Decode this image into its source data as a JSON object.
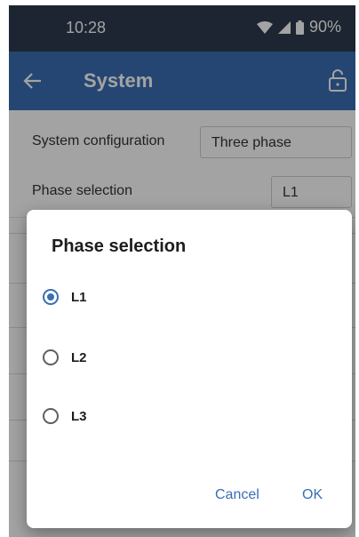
{
  "status_bar": {
    "time": "10:28",
    "battery": "90%"
  },
  "app_bar": {
    "title": "System"
  },
  "settings": [
    {
      "label": "System configuration",
      "value": "Three phase"
    },
    {
      "label": "Phase selection",
      "value": "L1"
    }
  ],
  "dialog": {
    "title": "Phase selection",
    "options": [
      {
        "label": "L1",
        "selected": true
      },
      {
        "label": "L2",
        "selected": false
      },
      {
        "label": "L3",
        "selected": false
      }
    ],
    "cancel_label": "Cancel",
    "ok_label": "OK"
  },
  "colors": {
    "accent": "#3a6eb2",
    "status_bar": "#2c3a4e"
  },
  "icons": [
    "back-arrow-icon",
    "lock-icon",
    "wifi-icon",
    "cell-signal-icon",
    "battery-icon"
  ]
}
